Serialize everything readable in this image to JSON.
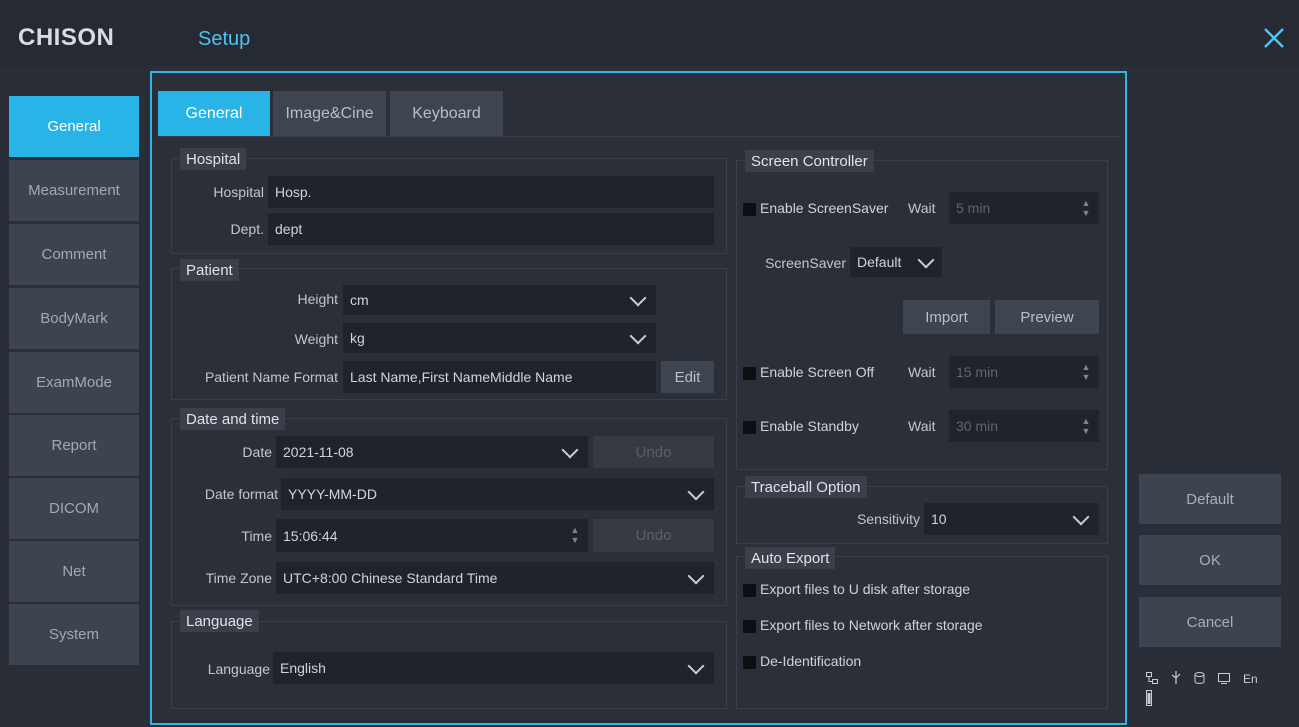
{
  "header": {
    "logo": "CHISON",
    "title": "Setup"
  },
  "sidebar": {
    "items": [
      {
        "label": "General",
        "active": true
      },
      {
        "label": "Measurement"
      },
      {
        "label": "Comment"
      },
      {
        "label": "BodyMark"
      },
      {
        "label": "ExamMode"
      },
      {
        "label": "Report"
      },
      {
        "label": "DICOM"
      },
      {
        "label": "Net"
      },
      {
        "label": "System"
      }
    ]
  },
  "tabs": [
    {
      "label": "General",
      "active": true
    },
    {
      "label": "Image&Cine"
    },
    {
      "label": "Keyboard"
    }
  ],
  "hospital": {
    "title": "Hospital",
    "hospital_label": "Hospital",
    "hospital_value": "Hosp.",
    "dept_label": "Dept.",
    "dept_value": "dept"
  },
  "patient": {
    "title": "Patient",
    "height_label": "Height",
    "height_value": "cm",
    "weight_label": "Weight",
    "weight_value": "kg",
    "name_format_label": "Patient Name Format",
    "name_format_value": "Last Name,First NameMiddle Name",
    "edit_label": "Edit"
  },
  "datetime": {
    "title": "Date and time",
    "date_label": "Date",
    "date_value": "2021-11-08",
    "date_undo": "Undo",
    "format_label": "Date format",
    "format_value": "YYYY-MM-DD",
    "time_label": "Time",
    "time_value": "15:06:44",
    "time_undo": "Undo",
    "tz_label": "Time Zone",
    "tz_value": "UTC+8:00 Chinese Standard Time"
  },
  "language": {
    "title": "Language",
    "label": "Language",
    "value": "English"
  },
  "screen": {
    "title": "Screen Controller",
    "saver_enable": "Enable ScreenSaver",
    "saver_wait_label": "Wait",
    "saver_wait": "5 min",
    "saver_label": "ScreenSaver",
    "saver_value": "Default",
    "import_label": "Import",
    "preview_label": "Preview",
    "off_enable": "Enable Screen Off",
    "off_wait_label": "Wait",
    "off_wait": "15 min",
    "standby_enable": "Enable Standby",
    "standby_wait_label": "Wait",
    "standby_wait": "30 min"
  },
  "traceball": {
    "title": "Traceball Option",
    "sensitivity_label": "Sensitivity",
    "sensitivity_value": "10"
  },
  "export": {
    "title": "Auto Export",
    "udisk": "Export files to U disk after storage",
    "network": "Export files to Network after storage",
    "deid": "De-Identification"
  },
  "actions": {
    "default": "Default",
    "ok": "OK",
    "cancel": "Cancel"
  },
  "status": {
    "lang": "En"
  },
  "colors": {
    "accent": "#29b4e8",
    "background": "#2a2e36",
    "field": "#1f232b"
  }
}
